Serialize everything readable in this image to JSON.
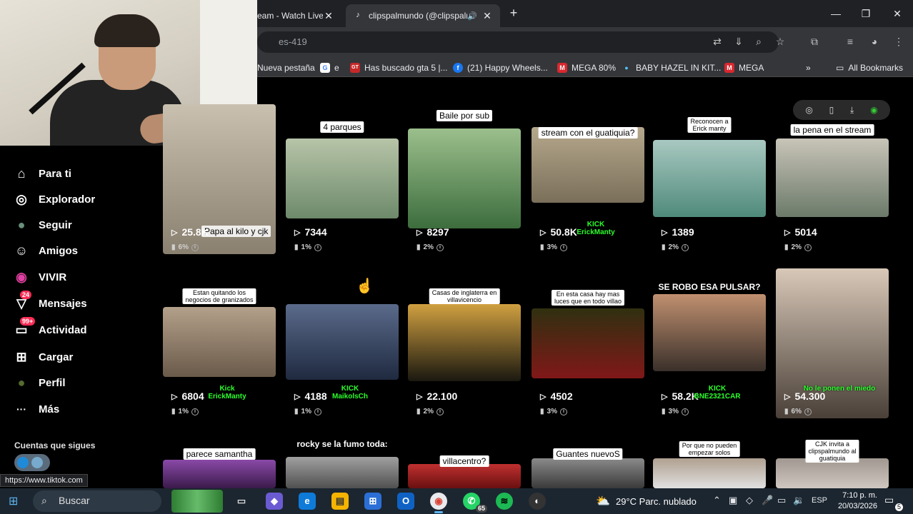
{
  "browser": {
    "tabs": [
      {
        "title": "eam - Watch Live",
        "close": "✕"
      },
      {
        "title": "clipspalmundo (@clipspalm",
        "close": "✕"
      }
    ],
    "new_tab": "+",
    "window_controls": [
      "—",
      "❐",
      "✕"
    ],
    "address_text": "es-419",
    "bookmarks": [
      {
        "label": "Nueva pestaña",
        "icon_color": "#35363a"
      },
      {
        "label": "e",
        "icon": "G",
        "icon_color": "#ffffff"
      },
      {
        "label": "Has buscado gta 5 |...",
        "icon": "GT",
        "icon_color": "#c62828"
      },
      {
        "label": "(21) Happy Wheels...",
        "icon": "f",
        "icon_color": "#1877f2"
      },
      {
        "label": "MEGA 80%",
        "icon": "M",
        "icon_color": "#d9272e"
      },
      {
        "label": "BABY HAZEL IN KIT...",
        "icon": "●",
        "icon_color": "#4fc3f7"
      },
      {
        "label": "MEGA",
        "icon": "M",
        "icon_color": "#d9272e"
      }
    ],
    "bookmarks_more": "»",
    "all_bookmarks": "All Bookmarks",
    "status_url": "https://www.tiktok.com"
  },
  "sidebar": {
    "items": [
      {
        "label": "Para ti",
        "icon": "⌂"
      },
      {
        "label": "Explorador",
        "icon": "◎"
      },
      {
        "label": "Seguir",
        "icon": "●"
      },
      {
        "label": "Amigos",
        "icon": "☺"
      },
      {
        "label": "VIVIR",
        "icon": "◉"
      },
      {
        "label": "Mensajes",
        "icon": "▽",
        "badge": "24"
      },
      {
        "label": "Actividad",
        "icon": "▭",
        "badge": "99+"
      },
      {
        "label": "Cargar",
        "icon": "⊞"
      },
      {
        "label": "Perfil",
        "icon": "●"
      },
      {
        "label": "Más",
        "icon": "···"
      }
    ],
    "following_title": "Cuentas que sigues"
  },
  "videos": [
    {
      "caption": "Papa al kilo y cjk",
      "views": "25.8K",
      "pct": "6%"
    },
    {
      "caption": "4 parques",
      "views": "7344",
      "pct": "1%"
    },
    {
      "caption": "Baile por sub",
      "views": "8297",
      "pct": "2%"
    },
    {
      "caption": "stream con el guatiquia?",
      "views": "50.8K",
      "pct": "3%",
      "overlay": "KICK\nErickManty"
    },
    {
      "caption": "Reconocen a\nErick manty",
      "views": "1389",
      "pct": "2%"
    },
    {
      "caption": "la pena en el stream",
      "views": "5014",
      "pct": "2%"
    },
    {
      "caption": "Estan quitando los\nnegocios de granizados",
      "views": "6804",
      "pct": "1%",
      "overlay": "Kick\nErickManty"
    },
    {
      "caption": "",
      "views": "4188",
      "pct": "1%",
      "overlay": "KICK\nMaikolsCh"
    },
    {
      "caption": "Casas de inglaterra en\nvillavicencio",
      "views": "22.100",
      "pct": "2%"
    },
    {
      "caption": "En esta casa hay mas\nluces que en todo villao",
      "views": "4502",
      "pct": "3%"
    },
    {
      "caption": "SE ROBO ESA PULSAR?",
      "views": "58.2K",
      "pct": "3%",
      "overlay": "KICK\nBNE2321CAR"
    },
    {
      "caption": "",
      "views": "54.300",
      "pct": "6%",
      "overlay": "No le ponen el miedo"
    },
    {
      "caption": "parece samantha",
      "views": "",
      "pct": ""
    },
    {
      "caption": "rocky se la fumo toda:",
      "views": "",
      "pct": ""
    },
    {
      "caption": "villacentro?",
      "views": "",
      "pct": ""
    },
    {
      "caption": "Guantes nuevoS",
      "views": "",
      "pct": ""
    },
    {
      "caption": "Por que no pueden\nempezar solos",
      "views": "",
      "pct": ""
    },
    {
      "caption": "CJK invita a\nclipspalmundo al\nguatiquia",
      "views": "",
      "pct": ""
    }
  ],
  "taskbar": {
    "search_label": "Buscar",
    "weather": "29°C  Parc. nublado",
    "lang": "ESP",
    "time": "7:10 p. m.",
    "date": "20/03/2026",
    "whatsapp_badge": "65",
    "notif_badge": "5"
  }
}
